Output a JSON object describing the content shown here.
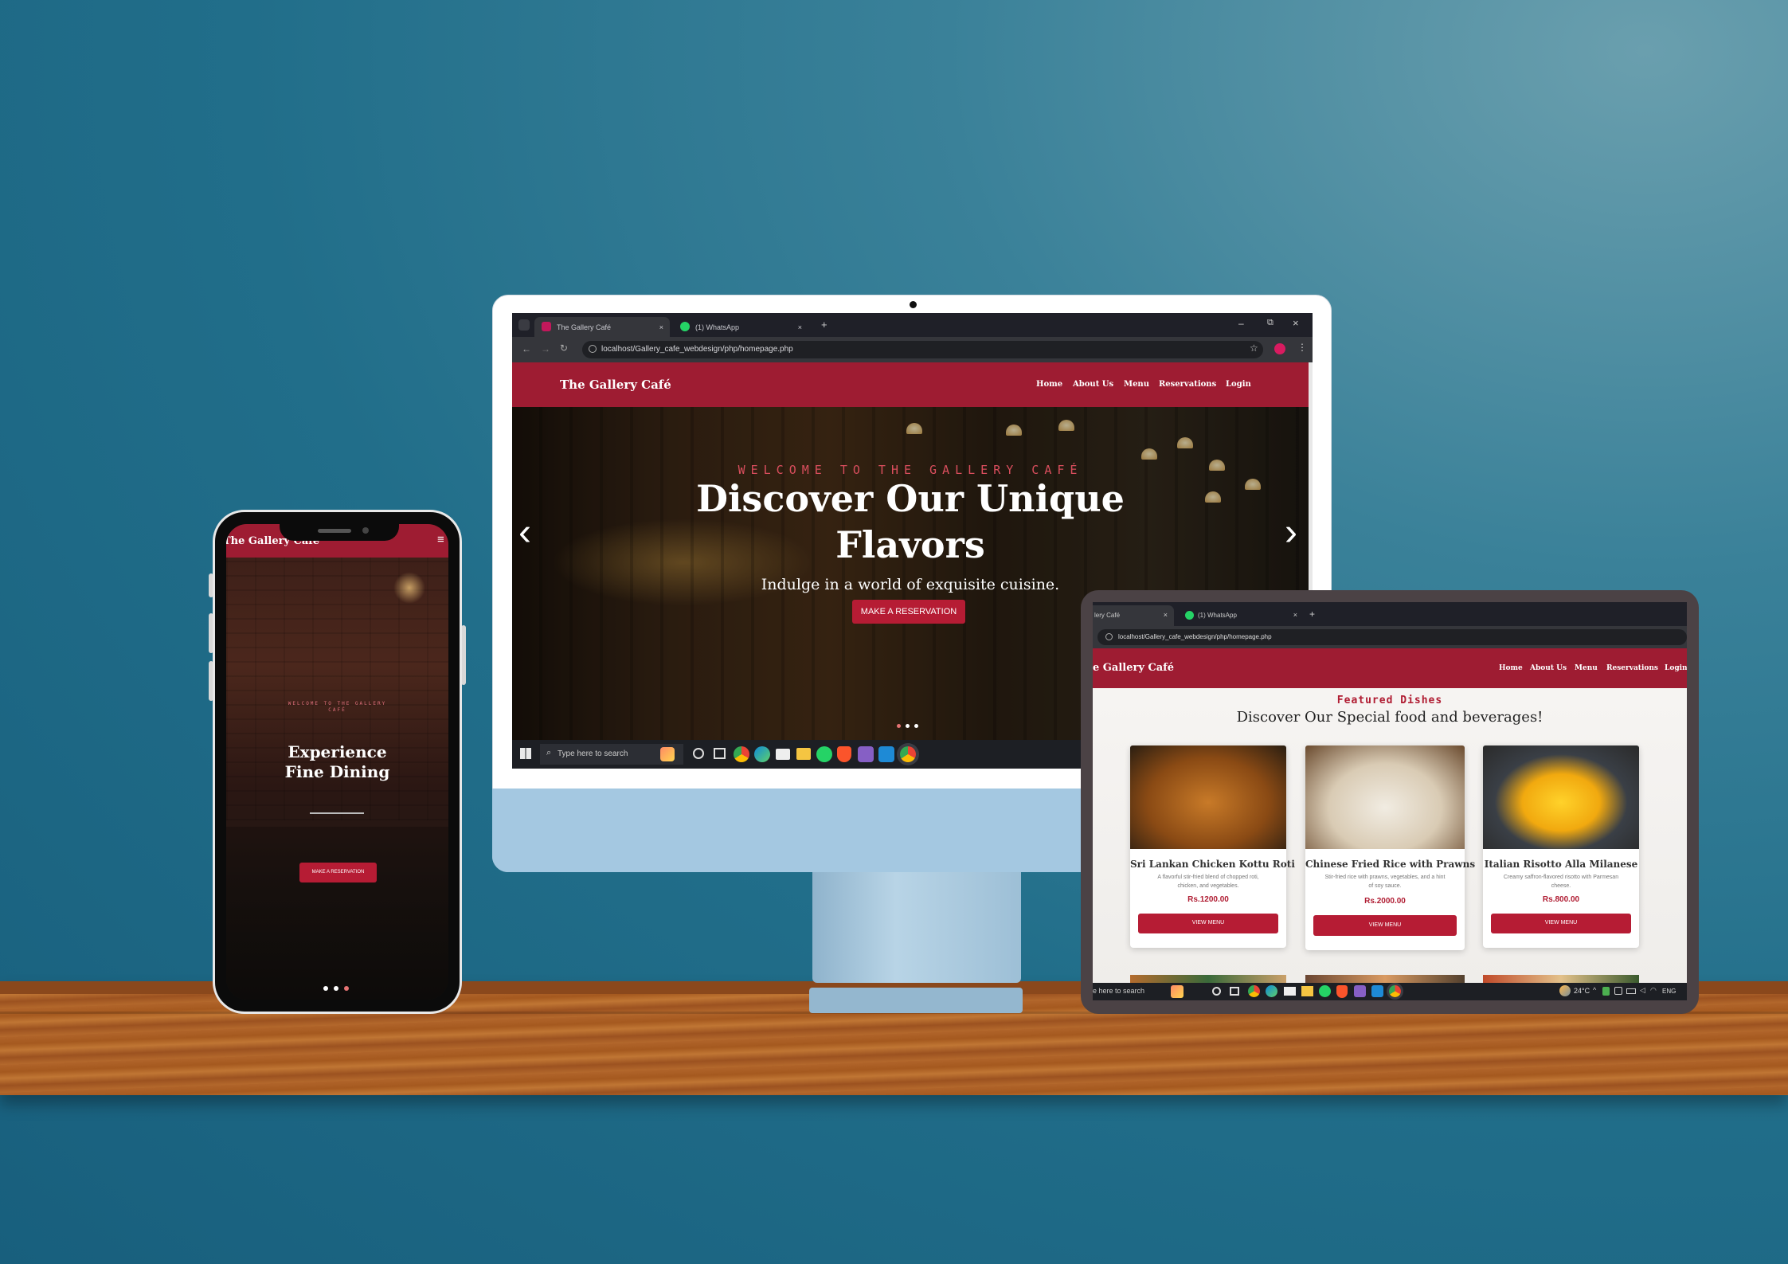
{
  "desktop": {
    "tabs": [
      {
        "label": "The Gallery Café",
        "close": "×"
      },
      {
        "label": "(1) WhatsApp",
        "close": "×"
      }
    ],
    "new_tab": "+",
    "window_controls": [
      "–",
      "⧉",
      "×"
    ],
    "url": "localhost/Gallery_cafe_webdesign/php/homepage.php",
    "brand": "The Gallery Café",
    "nav": [
      "Home",
      "About Us",
      "Menu",
      "Reservations",
      "Login"
    ],
    "hero_kicker": "WELCOME TO THE GALLERY CAFÉ",
    "hero_title_line1": "Discover Our Unique",
    "hero_title_line2": "Flavors",
    "hero_subtitle": "Indulge in a world of exquisite cuisine.",
    "hero_button": "MAKE A RESERVATION",
    "prev_arrow": "‹",
    "next_arrow": "›",
    "search_placeholder": "Type here to search"
  },
  "phone": {
    "brand": "The Gallery Café",
    "menu_icon": "≡",
    "kicker": "WELCOME TO THE GALLERY CAFÉ",
    "title_line1": "Experience",
    "title_line2": "Fine Dining",
    "button": "MAKE A RESERVATION"
  },
  "tablet": {
    "tabs": [
      {
        "label": "lery Café",
        "close": "×"
      },
      {
        "label": "(1) WhatsApp",
        "close": "×"
      }
    ],
    "new_tab": "+",
    "url": "localhost/Gallery_cafe_webdesign/php/homepage.php",
    "brand": "e Gallery Café",
    "nav": [
      "Home",
      "About Us",
      "Menu",
      "Reservations",
      "Login"
    ],
    "section_kicker": "Featured Dishes",
    "section_title": "Discover Our Special food and beverages!",
    "dishes": [
      {
        "name": "Sri Lankan Chicken Kottu Roti",
        "desc1": "A flavorful stir-fried blend of chopped roti,",
        "desc2": "chicken, and vegetables.",
        "price": "Rs.1200.00",
        "button": "VIEW MENU"
      },
      {
        "name": "Chinese Fried Rice with Prawns",
        "desc1": "Stir-fried rice with prawns, vegetables, and a hint",
        "desc2": "of soy sauce.",
        "price": "Rs.2000.00",
        "button": "VIEW MENU"
      },
      {
        "name": "Italian Risotto Alla Milanese",
        "desc1": "Creamy saffron-flavored risotto with Parmesan",
        "desc2": "cheese.",
        "price": "Rs.800.00",
        "button": "VIEW MENU"
      }
    ],
    "search_placeholder": "e here to search",
    "weather": "24°C",
    "lang": "ENG"
  },
  "colors": {
    "brand_red": "#9e1c32",
    "button_red": "#b61c34",
    "wall_blue": "#216e8a"
  }
}
